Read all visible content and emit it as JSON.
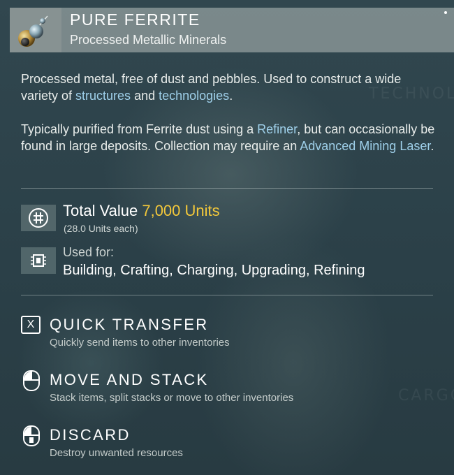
{
  "item": {
    "title": "PURE FERRITE",
    "subtitle": "Processed Metallic Minerals",
    "icon": "ferrite-orbs-icon"
  },
  "description": {
    "p1_a": "Processed metal, free of dust and pebbles. Used to construct a wide variety of ",
    "p1_link1": "structures",
    "p1_b": " and ",
    "p1_link2": "technologies",
    "p1_c": ".",
    "p2_a": "Typically purified from Ferrite dust using a ",
    "p2_link1": "Refiner",
    "p2_b": ", but can occasionally be found in large deposits. Collection may require an ",
    "p2_link2": "Advanced Mining Laser",
    "p2_c": "."
  },
  "value": {
    "label": "Total Value",
    "amount": "7,000 Units",
    "each": "(28.0 Units each)",
    "icon": "units-currency-icon"
  },
  "usage": {
    "label": "Used for:",
    "list": "Building, Crafting, Charging, Upgrading, Refining",
    "icon": "chip-icon"
  },
  "actions": [
    {
      "key": "X",
      "label": "QUICK TRANSFER",
      "desc": "Quickly send items to other inventories",
      "icon": "x-key-icon"
    },
    {
      "label": "MOVE AND STACK",
      "desc": "Stack items, split stacks or move to other inventories",
      "icon": "mouse-left-click-icon"
    },
    {
      "label": "DISCARD",
      "desc": "Destroy unwanted resources",
      "icon": "mouse-hold-icon"
    }
  ],
  "background_text": [
    "TECHNOL",
    "CARGO"
  ],
  "colors": {
    "accent_value": "#f3c83a",
    "link": "#9fd0ea",
    "panel_bg": "#2a3d44"
  }
}
